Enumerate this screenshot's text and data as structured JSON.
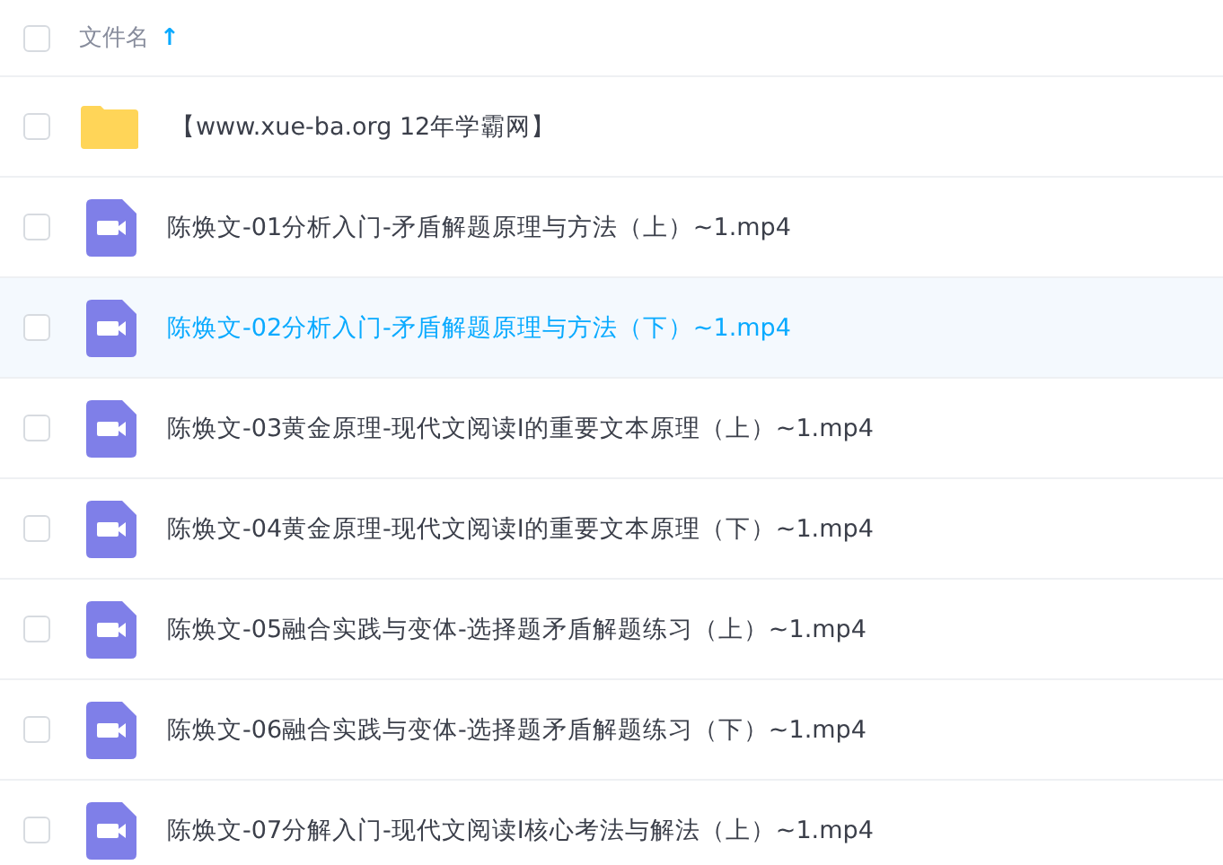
{
  "header": {
    "checked": false,
    "column_label": "文件名",
    "sort_indicator": "↑"
  },
  "files": [
    {
      "kind": "folder",
      "name": "【www.xue-ba.org 12年学霸网】",
      "checked": false,
      "highlighted": false
    },
    {
      "kind": "video",
      "name": "陈焕文-01分析入门-矛盾解题原理与方法（上）~1.mp4",
      "checked": false,
      "highlighted": false
    },
    {
      "kind": "video",
      "name": "陈焕文-02分析入门-矛盾解题原理与方法（下）~1.mp4",
      "checked": false,
      "highlighted": true
    },
    {
      "kind": "video",
      "name": "陈焕文-03黄金原理-现代文阅读I的重要文本原理（上）~1.mp4",
      "checked": false,
      "highlighted": false
    },
    {
      "kind": "video",
      "name": "陈焕文-04黄金原理-现代文阅读I的重要文本原理（下）~1.mp4",
      "checked": false,
      "highlighted": false
    },
    {
      "kind": "video",
      "name": "陈焕文-05融合实践与变体-选择题矛盾解题练习（上）~1.mp4",
      "checked": false,
      "highlighted": false
    },
    {
      "kind": "video",
      "name": "陈焕文-06融合实践与变体-选择题矛盾解题练习（下）~1.mp4",
      "checked": false,
      "highlighted": false
    },
    {
      "kind": "video",
      "name": "陈焕文-07分解入门-现代文阅读I核心考法与解法（上）~1.mp4",
      "checked": false,
      "highlighted": false
    }
  ]
}
